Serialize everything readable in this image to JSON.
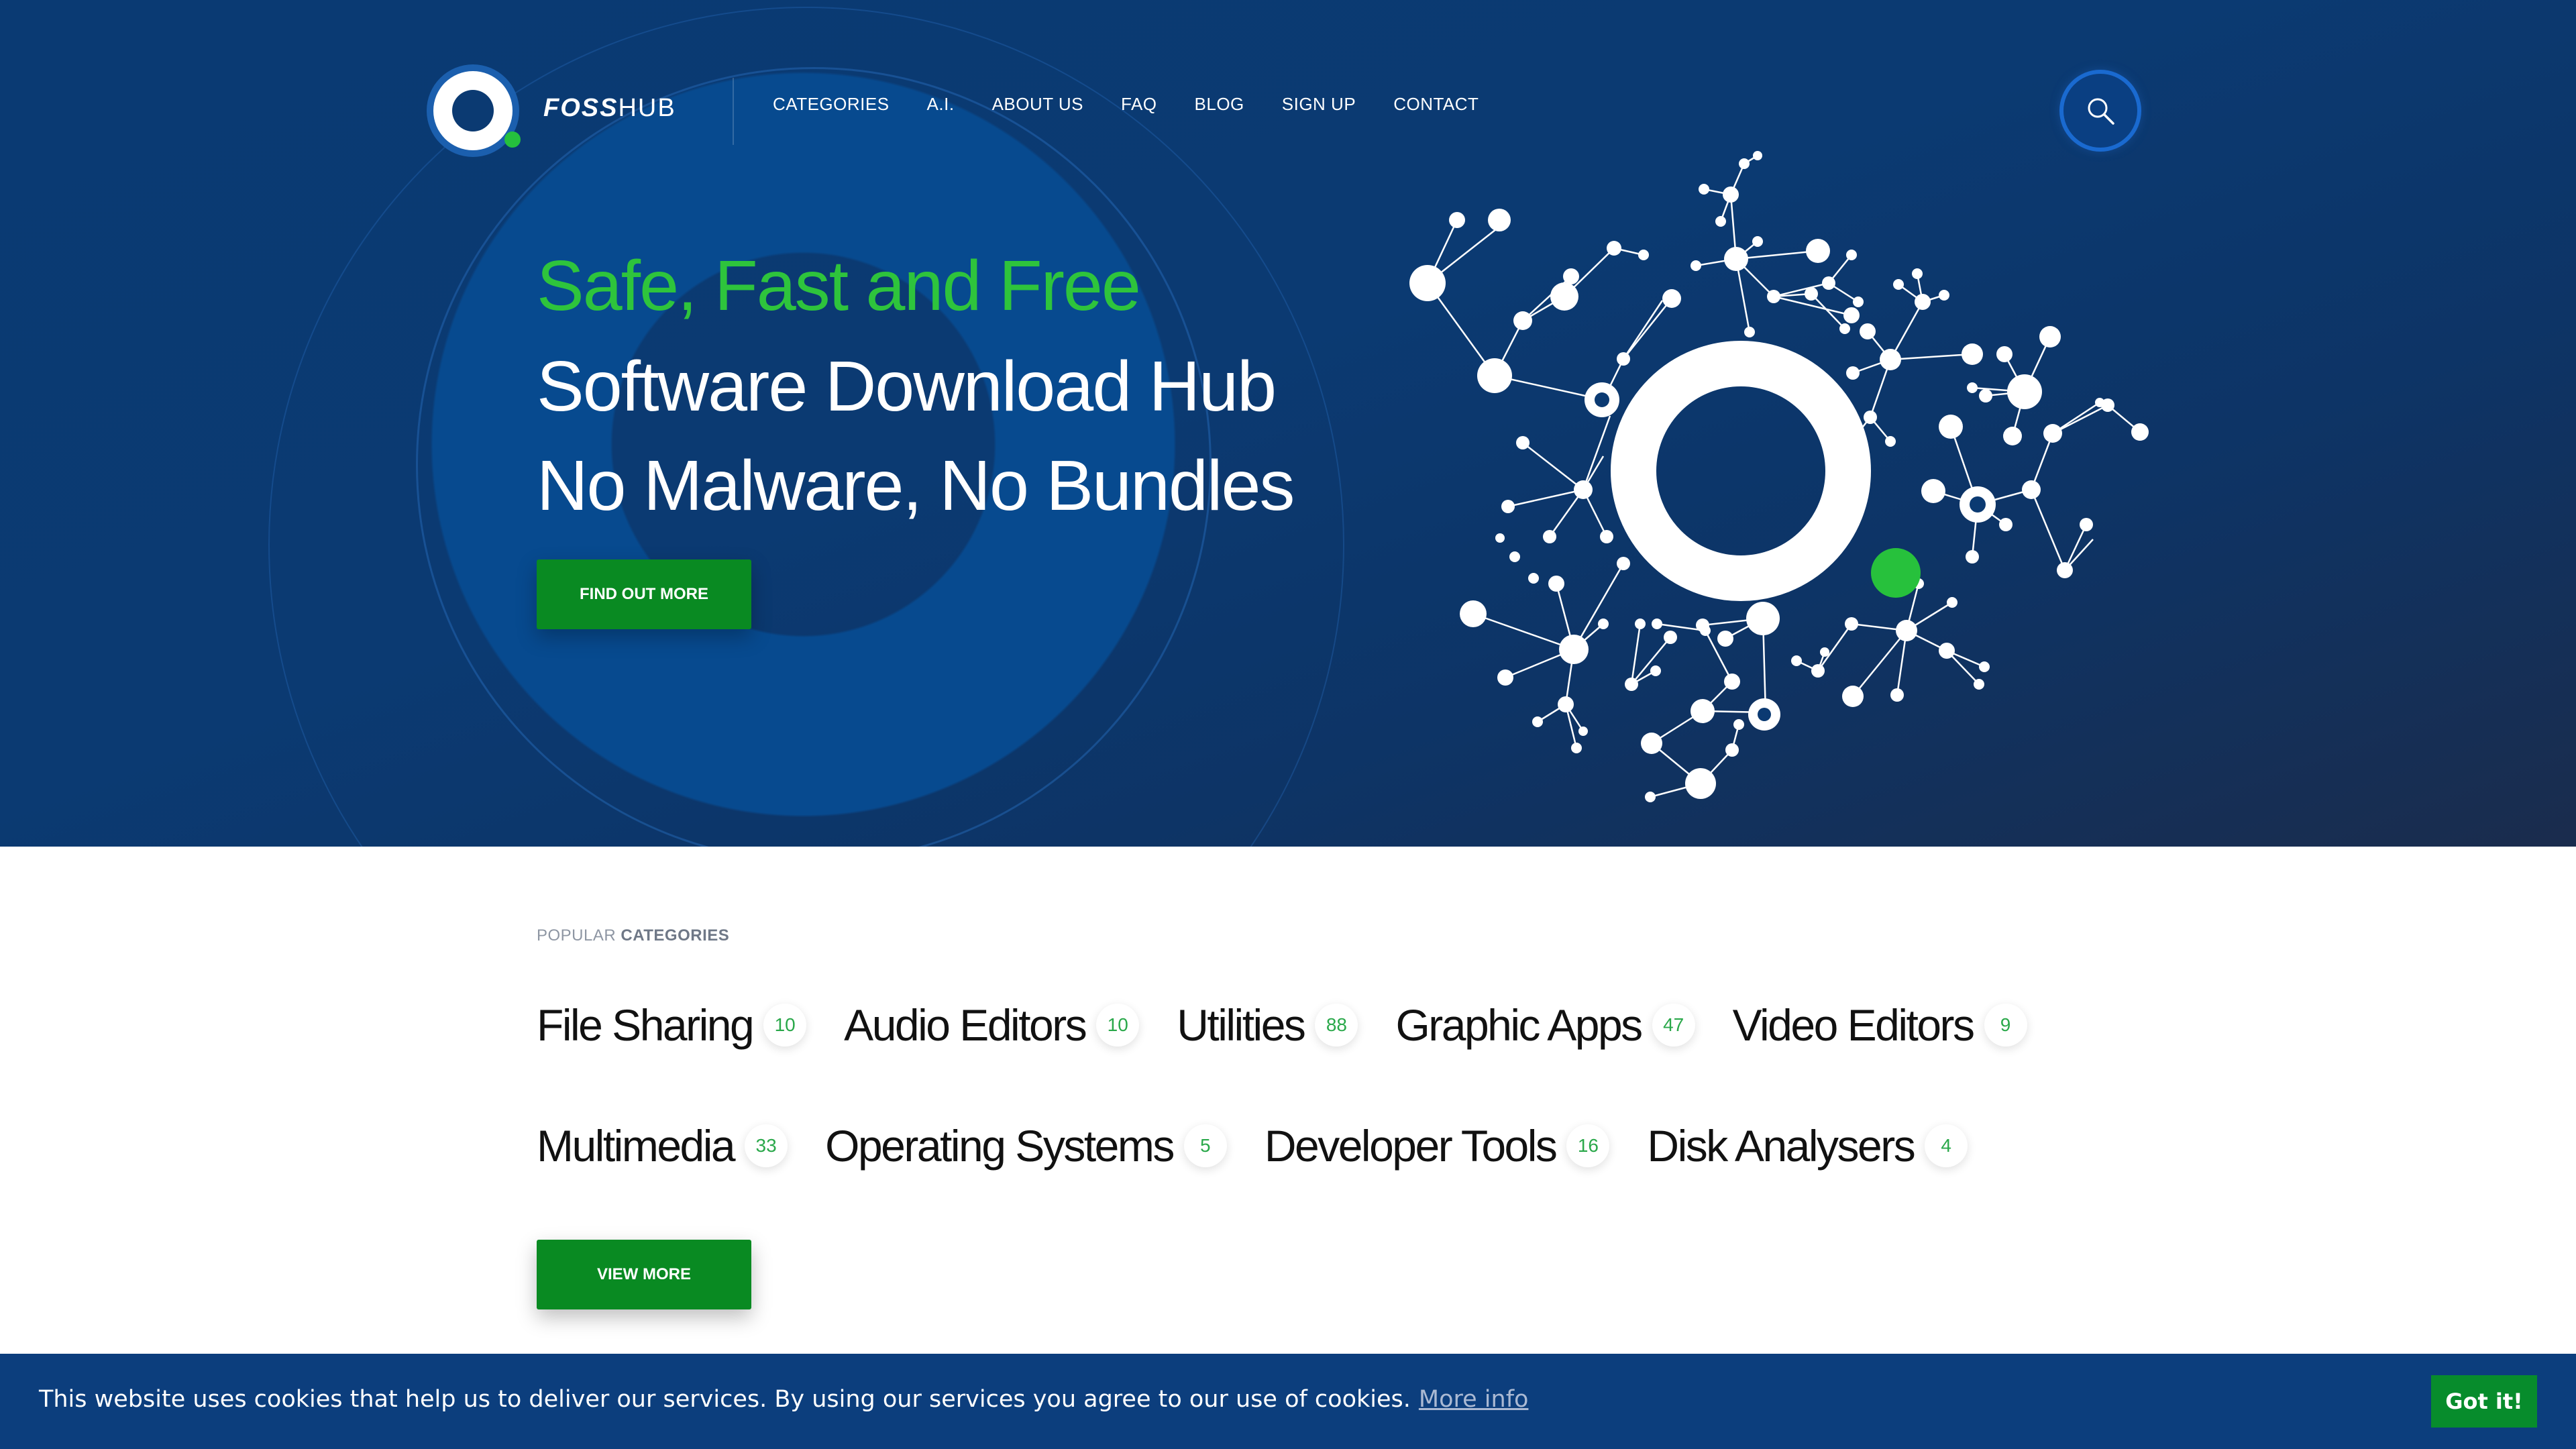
{
  "header": {
    "brand": {
      "bold": "FOSS",
      "light": "HUB"
    },
    "nav": [
      "CATEGORIES",
      "A.I.",
      "ABOUT US",
      "FAQ",
      "BLOG",
      "SIGN UP",
      "CONTACT"
    ],
    "search_icon": "magnifier-icon"
  },
  "hero": {
    "line1": "Safe, Fast and Free",
    "line2": "Software Download Hub",
    "line3": "No Malware, No Bundles",
    "cta": "FIND OUT MORE"
  },
  "popular": {
    "label_light": "POPULAR",
    "label_bold": "CATEGORIES",
    "row1": [
      {
        "name": "File Sharing",
        "count": "10"
      },
      {
        "name": "Audio Editors",
        "count": "10"
      },
      {
        "name": "Utilities",
        "count": "88"
      },
      {
        "name": "Graphic Apps",
        "count": "47"
      },
      {
        "name": "Video Editors",
        "count": "9"
      }
    ],
    "row2": [
      {
        "name": "Multimedia",
        "count": "33"
      },
      {
        "name": "Operating Systems",
        "count": "5"
      },
      {
        "name": "Developer Tools",
        "count": "16"
      },
      {
        "name": "Disk Analysers",
        "count": "4"
      }
    ],
    "cta": "VIEW MORE"
  },
  "cookie": {
    "text": "This website uses cookies that help us to deliver our services. By using our services you agree to our use of cookies.",
    "more": "More info",
    "accept": "Got it!"
  },
  "colors": {
    "hero_bg": "#0b3a72",
    "accent_green": "#2ec43c",
    "button_green": "#098a22",
    "cookie_bar": "#0c3e7d"
  }
}
